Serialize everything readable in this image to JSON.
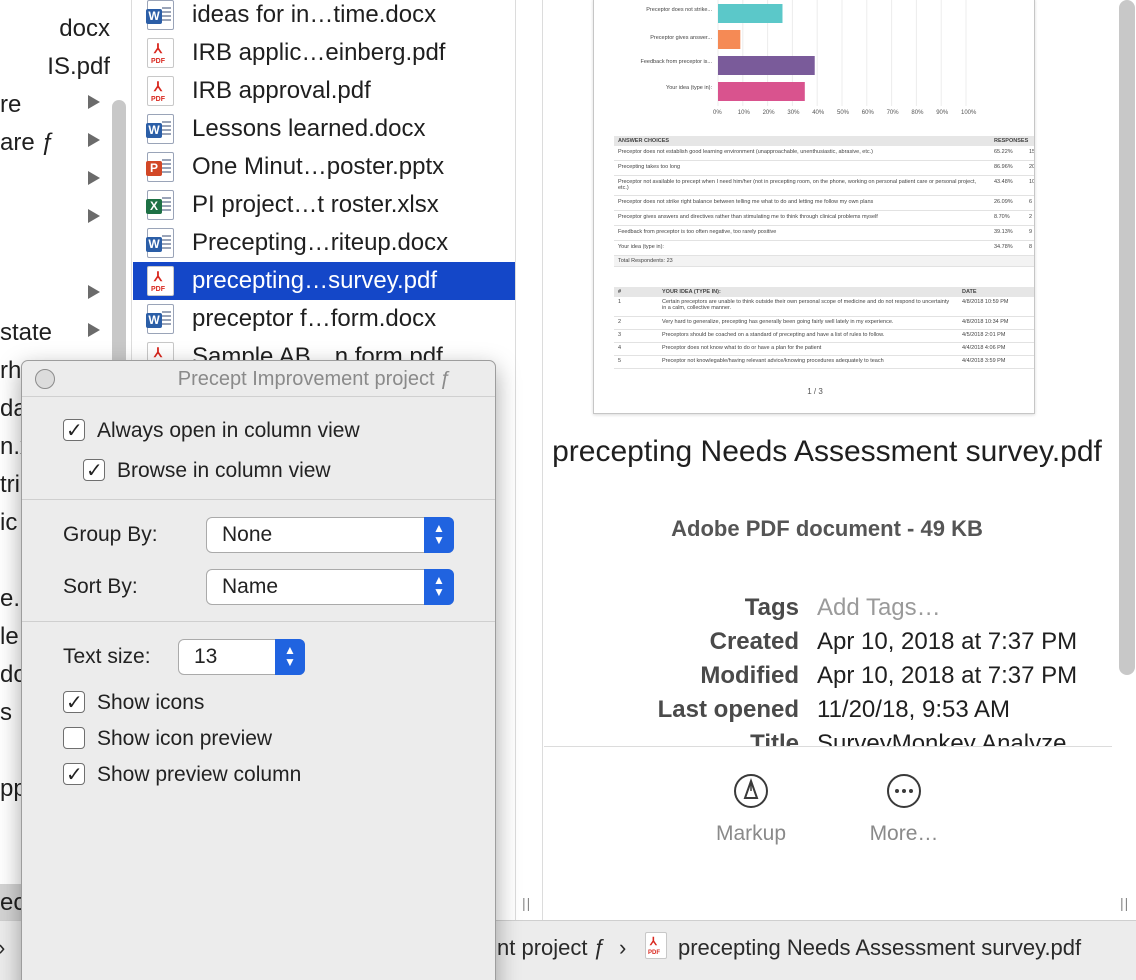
{
  "sidebar_column": {
    "rows": [
      {
        "text": "docx"
      },
      {
        "text": "IS.pdf"
      },
      {
        "text": "re"
      },
      {
        "text": "are ƒ"
      },
      {
        "text": ""
      },
      {
        "text": ""
      },
      {
        "text": ""
      },
      {
        "text": "state"
      },
      {
        "text": "rhc"
      },
      {
        "text": "da"
      },
      {
        "text": "n.x"
      },
      {
        "text": "tri"
      },
      {
        "text": "ic"
      },
      {
        "text": "e.p"
      },
      {
        "text": "le"
      },
      {
        "text": "do"
      },
      {
        "text": "s"
      },
      {
        "text": "pp"
      },
      {
        "text": "ec"
      }
    ]
  },
  "files": [
    {
      "name": "ideas for in…time.docx",
      "icon": "word-doc-icon"
    },
    {
      "name": "IRB applic…einberg.pdf",
      "icon": "pdf-icon"
    },
    {
      "name": "IRB approval.pdf",
      "icon": "pdf-icon"
    },
    {
      "name": "Lessons learned.docx",
      "icon": "word-doc-icon"
    },
    {
      "name": "One Minut…poster.pptx",
      "icon": "powerpoint-icon"
    },
    {
      "name": "PI project…t roster.xlsx",
      "icon": "excel-icon"
    },
    {
      "name": "Precepting…riteup.docx",
      "icon": "word-doc-icon"
    },
    {
      "name": "precepting…survey.pdf",
      "icon": "pdf-icon",
      "selected": true
    },
    {
      "name": "preceptor f…form.docx",
      "icon": "word-doc-icon"
    },
    {
      "name": "Sample AB…n form.pdf",
      "icon": "pdf-icon"
    }
  ],
  "preview": {
    "title": "precepting Needs Assessment survey.pdf",
    "kind": "Adobe PDF document - 49 KB",
    "metadata": [
      {
        "key": "Tags",
        "value": "Add Tags…",
        "placeholder": true
      },
      {
        "key": "Created",
        "value": "Apr 10, 2018 at 7:37 PM"
      },
      {
        "key": "Modified",
        "value": "Apr 10, 2018 at 7:37 PM"
      },
      {
        "key": "Last opened",
        "value": "11/20/18, 9:53 AM"
      },
      {
        "key": "Title",
        "value": "SurveyMonkey Analyze"
      }
    ],
    "actions": {
      "markup": "Markup",
      "more": "More…"
    },
    "thumbnail": {
      "bars": [
        {
          "label": "Preceptor does not strike...",
          "value": 26,
          "color": "#5bc8c9"
        },
        {
          "label": "Preceptor gives answer...",
          "value": 9,
          "color": "#f58a55"
        },
        {
          "label": "Feedback from preceptor is...",
          "value": 39,
          "color": "#7a5b9a"
        },
        {
          "label": "Your idea (type in):",
          "value": 35,
          "color": "#d9538e"
        }
      ],
      "ticks": [
        "0%",
        "10%",
        "20%",
        "30%",
        "40%",
        "50%",
        "60%",
        "70%",
        "80%",
        "90%",
        "100%"
      ],
      "answers_header": {
        "choices": "ANSWER CHOICES",
        "responses": "RESPONSES"
      },
      "answers": [
        {
          "text": "Preceptor does not establish good learning environment (unapproachable, unenthusiastic, abrasive, etc.)",
          "pct": "65.22%",
          "n": "15"
        },
        {
          "text": "Precepting takes too long",
          "pct": "86.96%",
          "n": "20"
        },
        {
          "text": "Preceptor not available to precept when I need him/her (not in precepting room, on the phone, working on personal patient care or personal project, etc.)",
          "pct": "43.48%",
          "n": "10"
        },
        {
          "text": "Preceptor does not strike right balance between telling me what to do and letting me follow my own plans",
          "pct": "26.09%",
          "n": "6"
        },
        {
          "text": "Preceptor gives answers and directives rather than stimulating me to think through clinical problems myself",
          "pct": "8.70%",
          "n": "2"
        },
        {
          "text": "Feedback from preceptor is too often negative, too rarely positive",
          "pct": "39.13%",
          "n": "9"
        },
        {
          "text": "Your idea (type in):",
          "pct": "34.78%",
          "n": "8"
        }
      ],
      "total": "Total Respondents: 23",
      "ideas_header": {
        "num": "#",
        "idea": "YOUR IDEA (TYPE IN):",
        "date": "DATE"
      },
      "ideas": [
        {
          "num": "1",
          "text": "Certain preceptors are unable to think outside their own personal scope of medicine and do not respond to uncertainty in a calm, collective manner.",
          "date": "4/8/2018 10:59 PM"
        },
        {
          "num": "2",
          "text": "Very hard to generalize, precepting has generally been going fairly well lately in my experience.",
          "date": "4/8/2018 10:34 PM"
        },
        {
          "num": "3",
          "text": "Preceptors should be coached on a standard of precepting and have a list of rules to follow.",
          "date": "4/5/2018 2:01 PM"
        },
        {
          "num": "4",
          "text": "Preceptor does not know what to do or have a plan for the patient",
          "date": "4/4/2018 4:06 PM"
        },
        {
          "num": "5",
          "text": "Preceptor not knowlegable/having relevant advice/knowing procedures adequately to teach",
          "date": "4/4/2018 3:59 PM"
        }
      ],
      "page": "1 / 3"
    }
  },
  "pathbar": {
    "parent": "nt project ƒ",
    "separator": "›",
    "current": "precepting Needs Assessment survey.pdf"
  },
  "view_options": {
    "title": "Precept Improvement project ƒ",
    "always_open_column": {
      "label": "Always open in column view",
      "checked": true
    },
    "browse_column": {
      "label": "Browse in column view",
      "checked": true
    },
    "group_by": {
      "label": "Group By:",
      "value": "None"
    },
    "sort_by": {
      "label": "Sort By:",
      "value": "Name"
    },
    "text_size": {
      "label": "Text size:",
      "value": "13"
    },
    "show_icons": {
      "label": "Show icons",
      "checked": true
    },
    "show_icon_preview": {
      "label": "Show icon preview",
      "checked": false
    },
    "show_preview_column": {
      "label": "Show preview column",
      "checked": true
    }
  }
}
